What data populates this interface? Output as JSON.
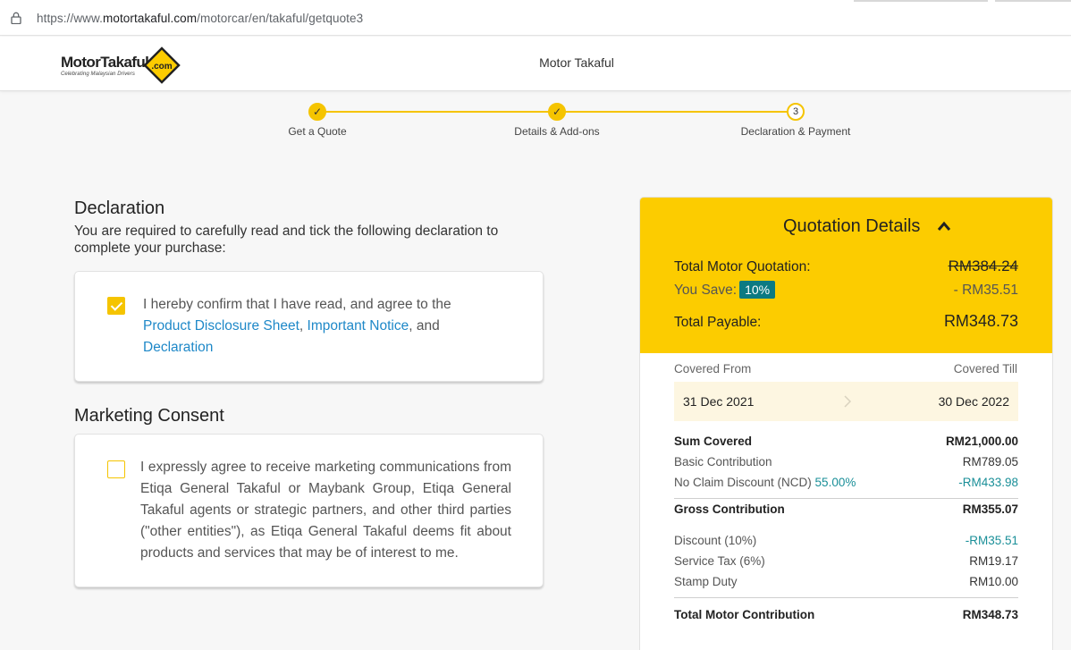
{
  "browser": {
    "url_scheme": "https://www.",
    "url_host": "motortakaful.com",
    "url_path": "/motorcar/en/takaful/getquote3"
  },
  "header": {
    "logo_text": "MotorTakaful",
    "logo_badge": ".com",
    "logo_tagline": "Celebrating Malaysian Drivers",
    "title": "Motor Takaful"
  },
  "stepper": {
    "steps": [
      {
        "label": "Get a Quote",
        "state": "done",
        "mark": "✓"
      },
      {
        "label": "Details & Add-ons",
        "state": "done",
        "mark": "✓"
      },
      {
        "label": "Declaration & Payment",
        "state": "current",
        "mark": "3"
      }
    ]
  },
  "declaration": {
    "title": "Declaration",
    "subtitle": "You are required to carefully read and tick the following declaration to complete your purchase:",
    "checked": true,
    "text_before": "I hereby confirm that I have read, and agree to the",
    "link1": "Product Disclosure Sheet",
    "sep1": ",",
    "link2": "Important Notice",
    "sep2": ", and",
    "link3": "Declaration"
  },
  "marketing": {
    "title": "Marketing Consent",
    "checked": false,
    "text": "I expressly agree to receive marketing communications from Etiqa General Takaful or Maybank Group, Etiqa General Takaful agents or strategic partners, and other third parties (\"other entities\"), as Etiqa General Takaful deems fit about products and services that may be of interest to me."
  },
  "quotation": {
    "title": "Quotation Details",
    "total_motor_label": "Total Motor Quotation:",
    "total_motor_value": "RM384.24",
    "you_save_label": "You Save:",
    "you_save_badge": "10%",
    "you_save_value": "- RM35.51",
    "total_payable_label": "Total Payable:",
    "total_payable_value": "RM348.73",
    "covered_from_label": "Covered From",
    "covered_till_label": "Covered Till",
    "covered_from": "31 Dec 2021",
    "covered_till": "30 Dec 2022",
    "sum_covered_label": "Sum Covered",
    "sum_covered_value": "RM21,000.00",
    "basic_label": "Basic Contribution",
    "basic_value": "RM789.05",
    "ncd_label": "No Claim Discount (NCD)",
    "ncd_pct": "55.00%",
    "ncd_value": "-RM433.98",
    "gross_label": "Gross Contribution",
    "gross_value": "RM355.07",
    "discount_label": "Discount (10%)",
    "discount_value": "-RM35.51",
    "tax_label": "Service Tax (6%)",
    "tax_value": "RM19.17",
    "stamp_label": "Stamp Duty",
    "stamp_value": "RM10.00",
    "total_label": "Total Motor Contribution",
    "total_value": "RM348.73"
  },
  "colors": {
    "accent": "#fccc00",
    "link": "#1e88c8",
    "teal": "#0c7a82"
  }
}
